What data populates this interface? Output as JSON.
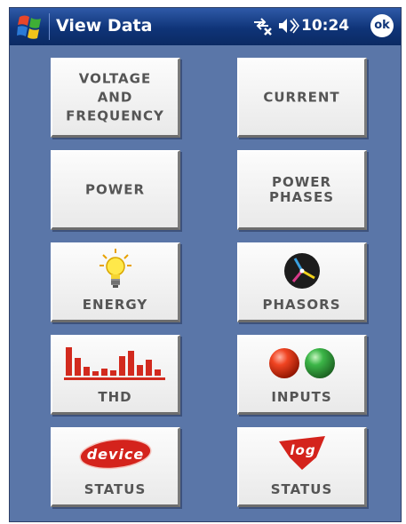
{
  "titlebar": {
    "title": "View Data",
    "clock": "10:24",
    "ok_label": "ok",
    "icons": [
      "windows-start-icon",
      "connectivity-icon",
      "speaker-muted-icon"
    ]
  },
  "tiles": {
    "voltage_frequency": {
      "line1": "VOLTAGE",
      "line2": "AND",
      "line3": "FREQUENCY"
    },
    "current": {
      "label": "CURRENT"
    },
    "power": {
      "label": "POWER"
    },
    "power_phases": {
      "line1": "POWER",
      "line2": "PHASES"
    },
    "energy": {
      "label": "ENERGY",
      "icon": "lightbulb-icon"
    },
    "phasors": {
      "label": "PHASORS",
      "icon": "phasor-diagram-icon"
    },
    "thd": {
      "label": "THD",
      "icon": "harmonics-bar-icon"
    },
    "inputs": {
      "label": "INPUTS",
      "icon": "red-green-leds-icon"
    },
    "device_status": {
      "label": "STATUS",
      "badge": "device"
    },
    "log_status": {
      "label": "STATUS",
      "badge": "log"
    }
  },
  "colors": {
    "background": "#5a76a8",
    "titlebar": "#0f3478",
    "tile_text": "#555555",
    "thd_bars": "#d22a1e"
  }
}
